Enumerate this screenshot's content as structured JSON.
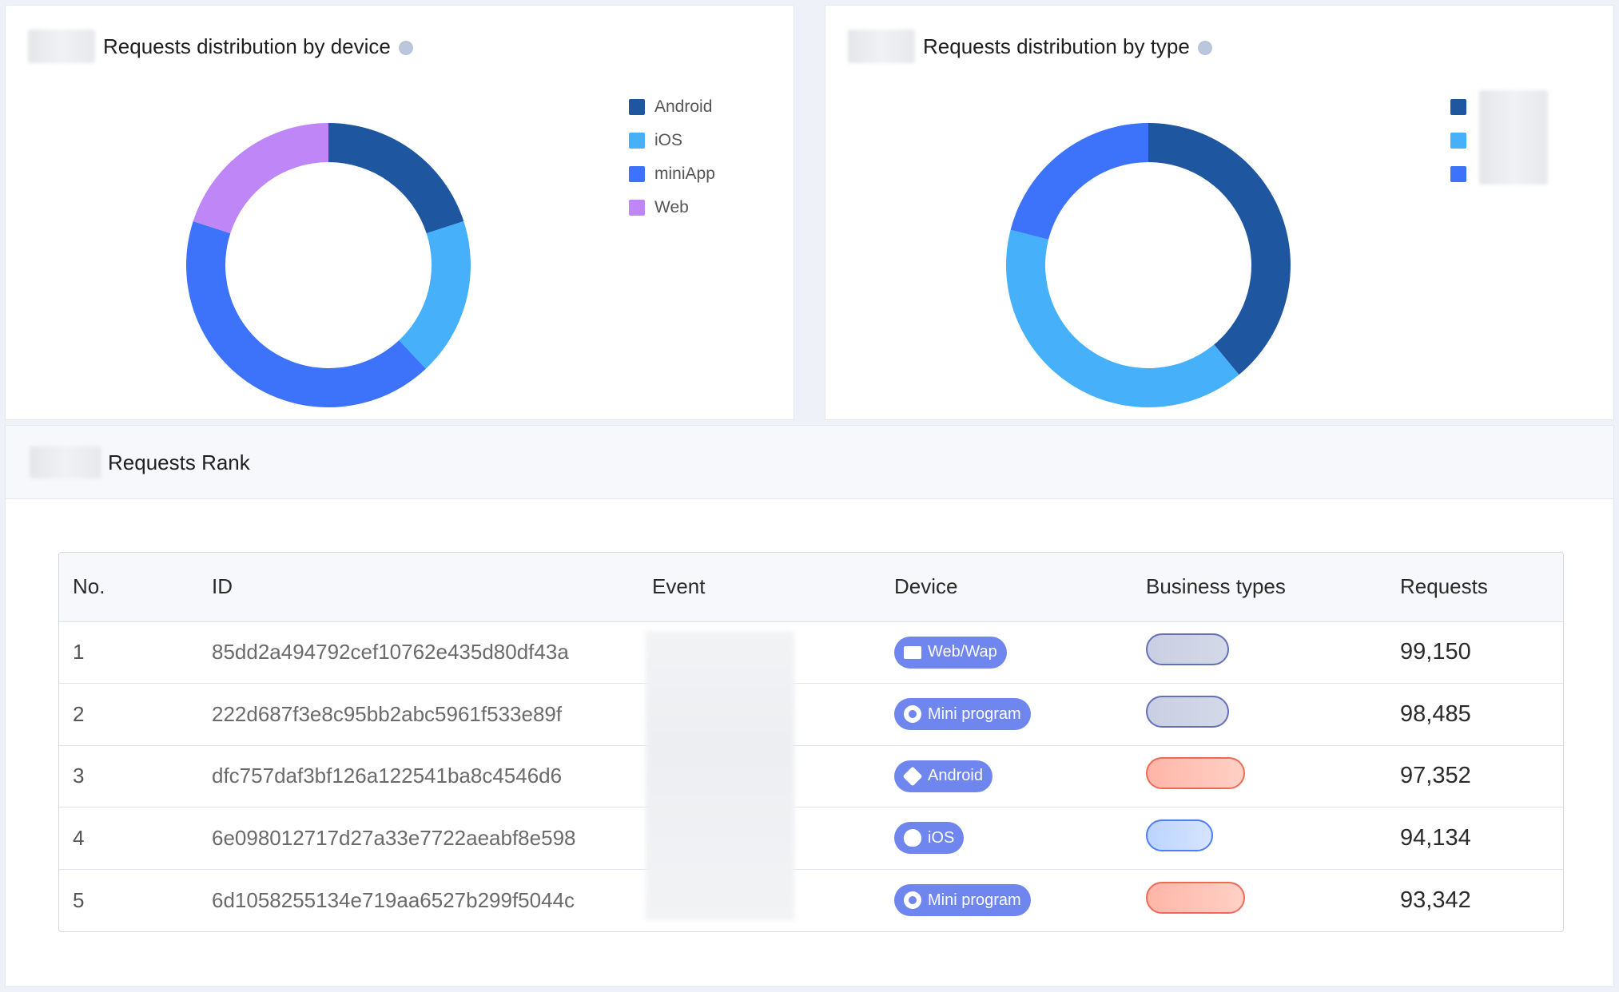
{
  "device_card": {
    "title": "Requests distribution by device",
    "icon": "info-icon",
    "chart_data": {
      "type": "pie",
      "title": "Requests distribution by device",
      "categories": [
        "Android",
        "iOS",
        "miniApp",
        "Web"
      ],
      "values": [
        20,
        18,
        42,
        20
      ],
      "colors": [
        "#1e56a0",
        "#47b0fa",
        "#3c73fa",
        "#be86f7"
      ],
      "donut": true,
      "legend": "top-right"
    }
  },
  "type_card": {
    "title": "Requests distribution by type",
    "icon": "info-icon",
    "chart_data": {
      "type": "pie",
      "title": "Requests distribution by type",
      "categories": [
        "",
        "",
        ""
      ],
      "values": [
        39,
        40,
        21
      ],
      "colors": [
        "#1e56a0",
        "#47b0fa",
        "#3c73fa"
      ],
      "donut": true,
      "legend": "top-right"
    }
  },
  "rank_card": {
    "title": "Requests Rank",
    "columns": [
      "No.",
      "ID",
      "Event",
      "Device",
      "Business types",
      "Requests"
    ],
    "rows": [
      {
        "no": "1",
        "id": "85dd2a494792cef10762e435d80df43a",
        "device": "Web/Wap",
        "device_icon": "browser-icon",
        "biz_color": "gray",
        "requests": "99,150"
      },
      {
        "no": "2",
        "id": "222d687f3e8c95bb2abc5961f533e89f",
        "device": "Mini program",
        "device_icon": "mini-program-icon",
        "biz_color": "gray",
        "requests": "98,485"
      },
      {
        "no": "3",
        "id": "dfc757daf3bf126a122541ba8c4546d6",
        "device": "Android",
        "device_icon": "android-icon",
        "biz_color": "red",
        "requests": "97,352"
      },
      {
        "no": "4",
        "id": "6e098012717d27a33e7722aeabf8e598",
        "device": "iOS",
        "device_icon": "apple-icon",
        "biz_color": "blue",
        "requests": "94,134"
      },
      {
        "no": "5",
        "id": "6d1058255134e719aa6527b299f5044c",
        "device": "Mini program",
        "device_icon": "mini-program-icon",
        "biz_color": "red",
        "requests": "93,342"
      }
    ]
  }
}
